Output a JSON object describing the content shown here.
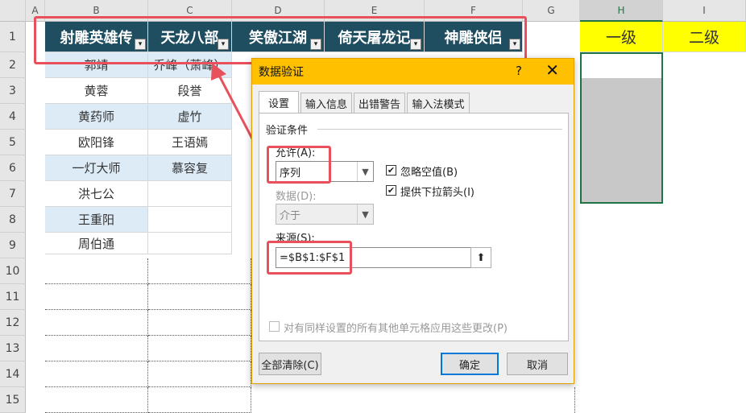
{
  "columns": [
    "A",
    "B",
    "C",
    "D",
    "E",
    "F",
    "G",
    "H",
    "I"
  ],
  "rows": [
    "1",
    "2",
    "3",
    "4",
    "5",
    "6",
    "7",
    "8",
    "9",
    "10",
    "11",
    "12",
    "13",
    "14",
    "15"
  ],
  "headers": [
    "射雕英雄传",
    "天龙八部",
    "笑傲江湖",
    "倚天屠龙记",
    "神雕侠侣"
  ],
  "col_b": [
    "郭靖",
    "黄蓉",
    "黄药师",
    "欧阳锋",
    "一灯大师",
    "洪七公",
    "王重阳",
    "周伯通"
  ],
  "col_c": [
    "乔峰（萧峰）",
    "段誉",
    "虚竹",
    "王语嫣",
    "慕容复"
  ],
  "level": {
    "h1": "一级",
    "i1": "二级"
  },
  "dialog": {
    "title": "数据验证",
    "help": "?",
    "close": "✕",
    "tabs": [
      "设置",
      "输入信息",
      "出错警告",
      "输入法模式"
    ],
    "section": "验证条件",
    "allow_label": "允许(A):",
    "allow_value": "序列",
    "ignore_blank": "忽略空值(B)",
    "dropdown": "提供下拉箭头(I)",
    "data_label": "数据(D):",
    "data_value": "介于",
    "source_label": "来源(S):",
    "source_value": "=$B$1:$F$1",
    "apply_all": "对有同样设置的所有其他单元格应用这些更改(P)",
    "clear_all": "全部清除(C)",
    "ok": "确定",
    "cancel": "取消"
  },
  "colors": {
    "header_bg": "#1f4e60",
    "accent": "#ffc000",
    "highlight": "#e8505b",
    "yellow": "#ffff00"
  }
}
